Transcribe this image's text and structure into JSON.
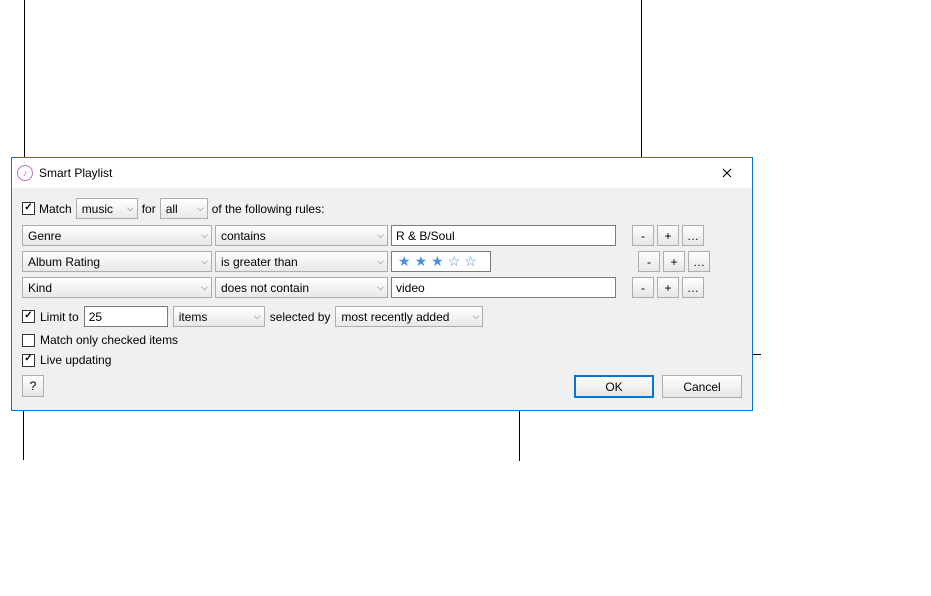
{
  "titlebar": {
    "title": "Smart Playlist"
  },
  "match_row": {
    "match_checked": true,
    "match_label": "Match",
    "media_type": "music",
    "for_label": "for",
    "scope": "all",
    "suffix": "of the following rules:"
  },
  "rules": [
    {
      "field": "Genre",
      "op": "contains",
      "value_type": "text",
      "value": "R & B/Soul"
    },
    {
      "field": "Album Rating",
      "op": "is greater than",
      "value_type": "rating",
      "rating_filled": 3,
      "rating_total": 5
    },
    {
      "field": "Kind",
      "op": "does not contain",
      "value_type": "text",
      "value": "video"
    }
  ],
  "rule_buttons": {
    "minus": "-",
    "plus": "+",
    "more": "…"
  },
  "options": {
    "limit_checked": true,
    "limit_label": "Limit to",
    "limit_value": "25",
    "limit_unit": "items",
    "selected_by_label": "selected by",
    "selected_by_value": "most recently added",
    "match_checked_items_checked": false,
    "match_checked_items_label": "Match only checked items",
    "live_updating_checked": true,
    "live_updating_label": "Live updating"
  },
  "footer": {
    "help": "?",
    "ok": "OK",
    "cancel": "Cancel"
  }
}
